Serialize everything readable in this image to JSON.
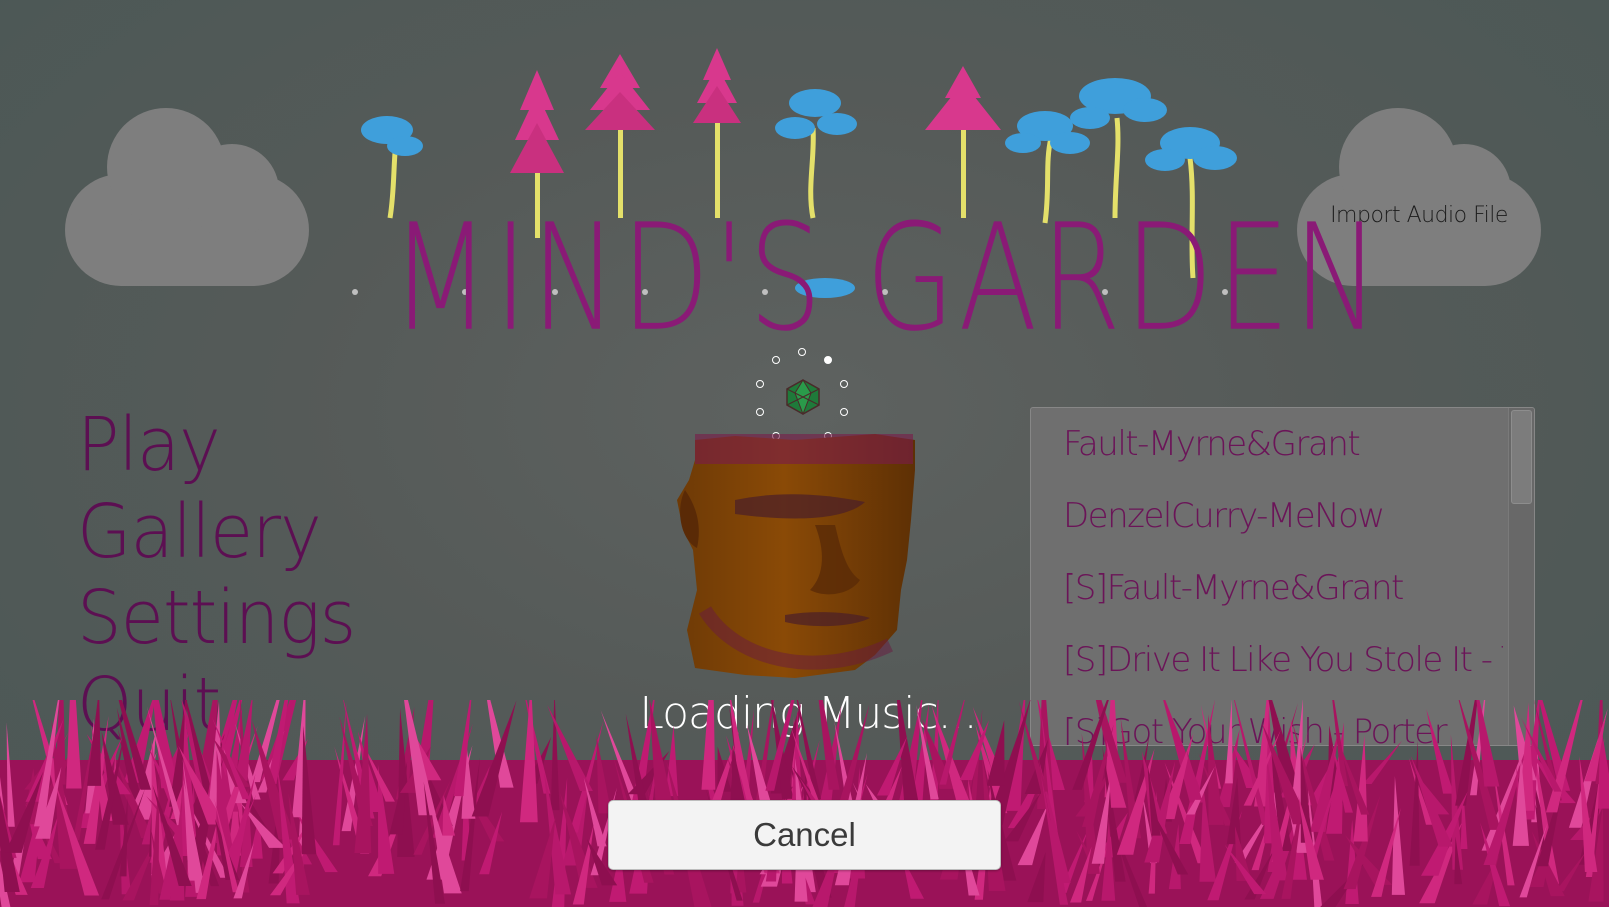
{
  "logo": {
    "title": "MIND'S GARDEN"
  },
  "menu": [
    {
      "label": "Play"
    },
    {
      "label": "Gallery"
    },
    {
      "label": "Settings"
    },
    {
      "label": "Quit"
    }
  ],
  "import": {
    "label": "Import Audio File"
  },
  "loading": {
    "text": "Loading Music..."
  },
  "songs": [
    {
      "title": "Fault-Myrne&Grant"
    },
    {
      "title": "DenzelCurry-MeNow"
    },
    {
      "title": "[S]Fault-Myrne&Grant"
    },
    {
      "title": "[S]Drive It Like You Stole It - The"
    },
    {
      "title": "[S]Got Your Wish - Porter"
    }
  ],
  "cancel": {
    "label": "Cancel"
  },
  "colors": {
    "accent_magenta": "#8a1a76",
    "grass_pink": "#b8186c",
    "tree_blue": "#3f9fdb",
    "tree_pink": "#d8388d",
    "cloud_gray": "#7e7e7e",
    "head_orange": "#8a4a06"
  },
  "icons": {
    "spinner": "loading-spinner-icon",
    "gem": "green-gem-icon"
  }
}
